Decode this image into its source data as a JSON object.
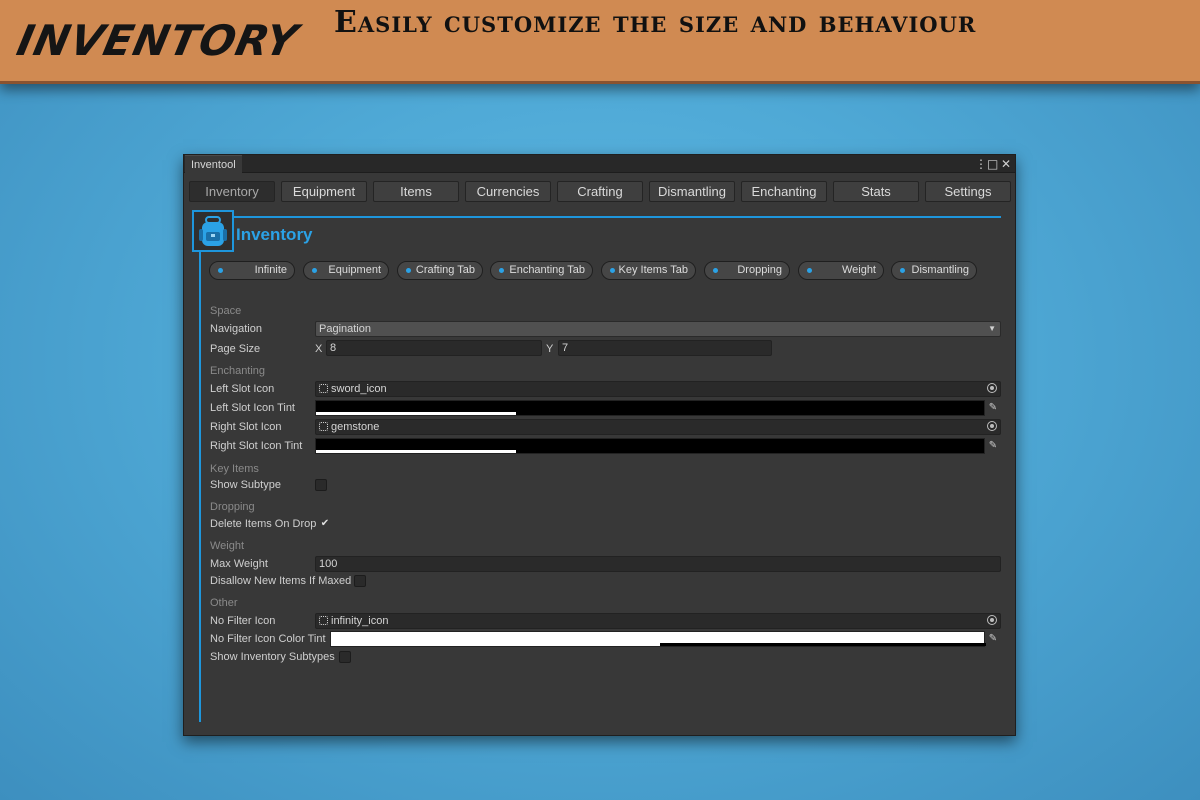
{
  "banner": {
    "logo": "INVENTORY",
    "headline": "Easily customize the size and behaviour"
  },
  "window": {
    "title": "Inventool",
    "controls": {
      "menu": "⋮",
      "maximize": "□",
      "close": "✕"
    },
    "tabs": [
      "Inventory",
      "Equipment",
      "Items",
      "Currencies",
      "Crafting",
      "Dismantling",
      "Enchanting",
      "Stats",
      "Settings"
    ],
    "active_tab": "Inventory",
    "accent_color": "#1e96dc"
  },
  "panel": {
    "title": "Inventory",
    "icon": "backpack-icon",
    "chips": [
      "Infinite",
      "Equipment",
      "Crafting Tab",
      "Enchanting Tab",
      "Key Items Tab",
      "Dropping",
      "Weight",
      "Dismantling"
    ]
  },
  "space": {
    "header": "Space",
    "navigation_label": "Navigation",
    "navigation_value": "Pagination",
    "page_size_label": "Page Size",
    "x_label": "X",
    "x_value": "8",
    "y_label": "Y",
    "y_value": "7"
  },
  "enchanting": {
    "header": "Enchanting",
    "left_icon_label": "Left Slot Icon",
    "left_icon_value": "sword_icon",
    "left_tint_label": "Left Slot Icon Tint",
    "left_tint_color": "#000000",
    "right_icon_label": "Right Slot Icon",
    "right_icon_value": "gemstone",
    "right_tint_label": "Right Slot Icon Tint",
    "right_tint_color": "#000000"
  },
  "key_items": {
    "header": "Key Items",
    "show_subtype_label": "Show Subtype",
    "show_subtype_checked": false
  },
  "dropping": {
    "header": "Dropping",
    "delete_label": "Delete Items On Drop",
    "delete_checked": true,
    "check_glyph": "✔"
  },
  "weight": {
    "header": "Weight",
    "max_label": "Max Weight",
    "max_value": "100",
    "disallow_label": "Disallow New Items If Maxed",
    "disallow_checked": false
  },
  "other": {
    "header": "Other",
    "no_filter_icon_label": "No Filter Icon",
    "no_filter_icon_value": "infinity_icon",
    "no_filter_tint_label": "No Filter Icon Color Tint",
    "no_filter_tint_color": "#ffffff",
    "show_subtypes_label": "Show Inventory Subtypes",
    "show_subtypes_checked": false
  }
}
